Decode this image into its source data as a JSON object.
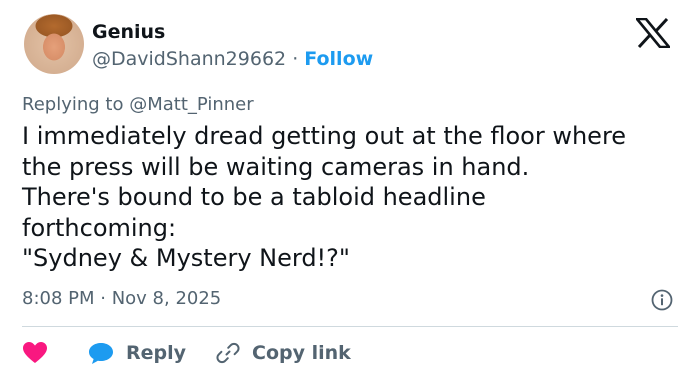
{
  "author": {
    "name": "Genius",
    "handle": "@DavidShann29662",
    "separator": "·",
    "follow_label": "Follow"
  },
  "reply_to": "Replying to @Matt_Pinner",
  "tweet_text": "I immediately dread getting out at the floor where\nthe press will be waiting cameras in hand.\nThere's bound to be a tabloid headline\nforthcoming:\n\"Sydney & Mystery Nerd!?\"",
  "timestamp": "8:08 PM · Nov 8, 2025",
  "actions": {
    "reply_label": "Reply",
    "copy_link_label": "Copy link"
  },
  "icons": {
    "like": "heart-icon",
    "reply": "chat-bubble-icon",
    "copy": "link-icon",
    "info": "info-icon",
    "brand": "x-logo-icon"
  },
  "colors": {
    "accent": "#1d9bf0",
    "like": "#f91880",
    "muted": "#536471",
    "text": "#0f1419",
    "divider": "#cfd9de"
  }
}
